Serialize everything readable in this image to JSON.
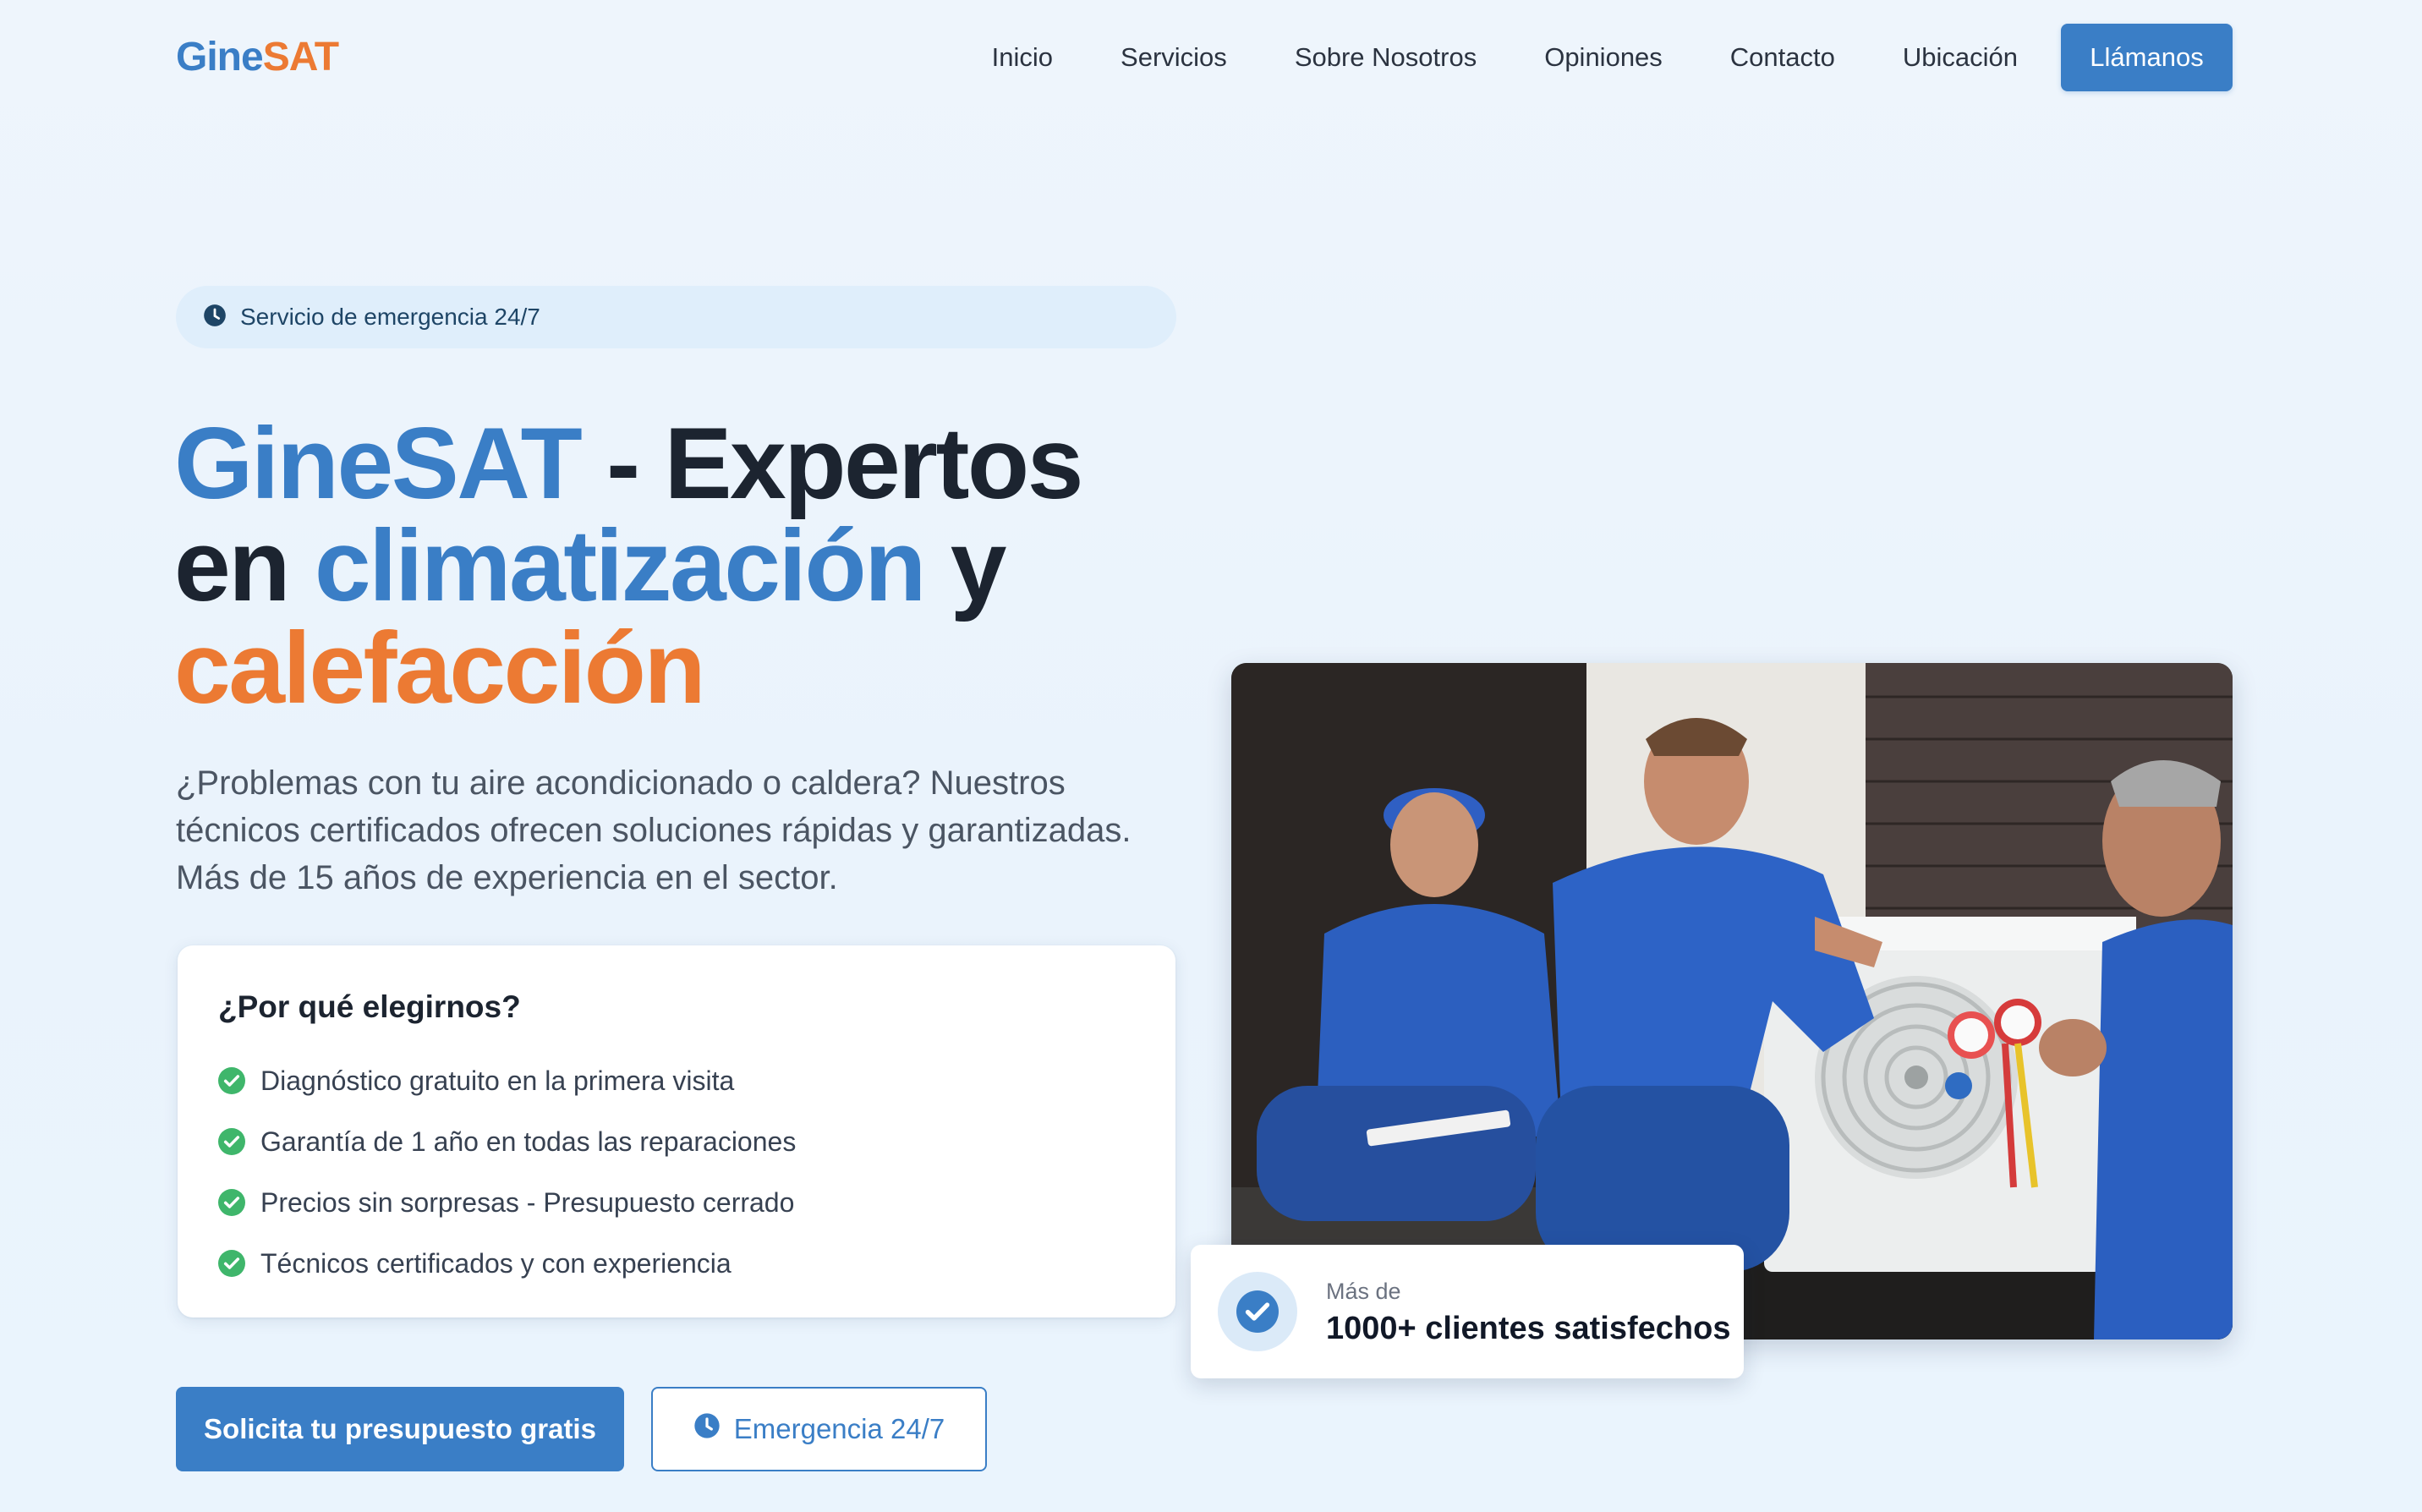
{
  "logo": {
    "part1": "Gine",
    "part2": "SAT"
  },
  "nav": {
    "items": [
      "Inicio",
      "Servicios",
      "Sobre Nosotros",
      "Opiniones",
      "Contacto",
      "Ubicación"
    ],
    "cta": "Llámanos"
  },
  "hero": {
    "badge": "Servicio de emergencia 24/7",
    "title": {
      "brand": "GineSAT",
      "p1": " - Expertos",
      "p2": "en ",
      "hl": "climatización",
      "p3": " y",
      "orange": "calefacción"
    },
    "lead": "¿Problemas con tu aire acondicionado o caldera? Nuestros técnicos certificados ofrecen soluciones rápidas y garantizadas. Más de 15 años de experiencia en el sector."
  },
  "why": {
    "title": "¿Por qué elegirnos?",
    "items": [
      "Diagnóstico gratuito en la primera visita",
      "Garantía de 1 año en todas las reparaciones",
      "Precios sin sorpresas - Presupuesto cerrado",
      "Técnicos certificados y con experiencia"
    ]
  },
  "buttons": {
    "primary": "Solicita tu presupuesto gratis",
    "emergency": "Emergencia 24/7"
  },
  "stat": {
    "small": "Más de",
    "big": "1000+ clientes satisfechos"
  },
  "colors": {
    "accent": "#3a7ec6",
    "orange": "#ec7a33",
    "check": "#3fb66b",
    "dark": "#1c2430"
  },
  "icons": {
    "badge": "clock-icon",
    "emergency": "clock-icon",
    "check": "check-circle-icon",
    "stat": "check-circle-icon"
  }
}
